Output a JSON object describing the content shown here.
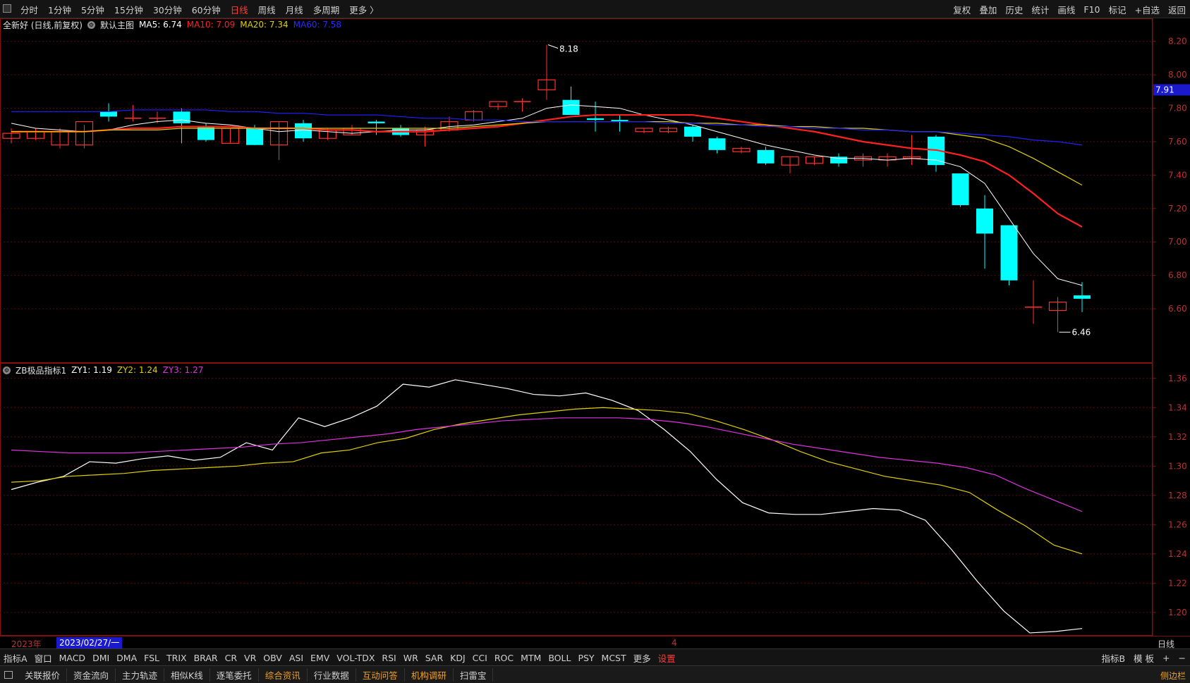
{
  "toolbar": {
    "periods": [
      "分时",
      "1分钟",
      "5分钟",
      "15分钟",
      "30分钟",
      "60分钟",
      "日线",
      "周线",
      "月线",
      "多周期",
      "更多 〉"
    ],
    "active_period": "日线",
    "tools": [
      "复权",
      "叠加",
      "历史",
      "统计",
      "画线",
      "F10",
      "标记",
      "+自选",
      "返回"
    ]
  },
  "main_legend": {
    "stock": "全新好 (日线,前复权)",
    "template": "默认主图",
    "ma5": "MA5: 6.74",
    "ma10": "MA10: 7.09",
    "ma20": "MA20: 7.34",
    "ma60": "MA60: 7.58"
  },
  "indicator_legend": {
    "name": "ZB极品指标1",
    "zy1": "ZY1: 1.19",
    "zy2": "ZY2: 1.24",
    "zy3": "ZY3: 1.27"
  },
  "colors": {
    "up": "#ff3030",
    "down": "#00ffff",
    "ma5": "#ffffff",
    "ma10": "#ff2020",
    "ma20": "#e0d000",
    "ma60": "#2020ff",
    "zy1": "#ffffff",
    "zy2": "#e0d000",
    "zy3": "#e030e0"
  },
  "chart_data": {
    "type": "candlestick",
    "price_axis": {
      "ylim": [
        6.44,
        8.22
      ],
      "ticks": [
        "8.20",
        "8.00",
        "7.80",
        "7.60",
        "7.40",
        "7.20",
        "7.00",
        "6.80",
        "6.60"
      ]
    },
    "last_price_tag": "7.91",
    "high_label": "8.18",
    "low_label": "6.46",
    "candles": [
      {
        "o": 7.62,
        "h": 7.68,
        "l": 7.59,
        "c": 7.65
      },
      {
        "o": 7.62,
        "h": 7.68,
        "l": 7.61,
        "c": 7.66
      },
      {
        "o": 7.58,
        "h": 7.68,
        "l": 7.56,
        "c": 7.66
      },
      {
        "o": 7.58,
        "h": 7.7,
        "l": 7.56,
        "c": 7.72
      },
      {
        "o": 7.78,
        "h": 7.83,
        "l": 7.72,
        "c": 7.75
      },
      {
        "o": 7.74,
        "h": 7.82,
        "l": 7.72,
        "c": 7.74
      },
      {
        "o": 7.74,
        "h": 7.78,
        "l": 7.71,
        "c": 7.74
      },
      {
        "o": 7.78,
        "h": 7.8,
        "l": 7.59,
        "c": 7.71
      },
      {
        "o": 7.69,
        "h": 7.71,
        "l": 7.6,
        "c": 7.61
      },
      {
        "o": 7.59,
        "h": 7.68,
        "l": 7.59,
        "c": 7.68
      },
      {
        "o": 7.68,
        "h": 7.7,
        "l": 7.58,
        "c": 7.58
      },
      {
        "o": 7.58,
        "h": 7.72,
        "l": 7.49,
        "c": 7.72
      },
      {
        "o": 7.71,
        "h": 7.73,
        "l": 7.6,
        "c": 7.62
      },
      {
        "o": 7.62,
        "h": 7.68,
        "l": 7.61,
        "c": 7.67
      },
      {
        "o": 7.64,
        "h": 7.7,
        "l": 7.64,
        "c": 7.68
      },
      {
        "o": 7.72,
        "h": 7.73,
        "l": 7.64,
        "c": 7.71
      },
      {
        "o": 7.68,
        "h": 7.7,
        "l": 7.63,
        "c": 7.64
      },
      {
        "o": 7.64,
        "h": 7.69,
        "l": 7.57,
        "c": 7.67
      },
      {
        "o": 7.67,
        "h": 7.75,
        "l": 7.66,
        "c": 7.72
      },
      {
        "o": 7.73,
        "h": 7.79,
        "l": 7.72,
        "c": 7.78
      },
      {
        "o": 7.81,
        "h": 7.83,
        "l": 7.79,
        "c": 7.84
      },
      {
        "o": 7.84,
        "h": 7.86,
        "l": 7.78,
        "c": 7.84
      },
      {
        "o": 7.91,
        "h": 8.18,
        "l": 7.85,
        "c": 7.97
      },
      {
        "o": 7.85,
        "h": 7.93,
        "l": 7.76,
        "c": 7.76
      },
      {
        "o": 7.74,
        "h": 7.84,
        "l": 7.66,
        "c": 7.73
      },
      {
        "o": 7.73,
        "h": 7.76,
        "l": 7.66,
        "c": 7.72
      },
      {
        "o": 7.66,
        "h": 7.68,
        "l": 7.65,
        "c": 7.68
      },
      {
        "o": 7.66,
        "h": 7.69,
        "l": 7.65,
        "c": 7.68
      },
      {
        "o": 7.69,
        "h": 7.7,
        "l": 7.6,
        "c": 7.63
      },
      {
        "o": 7.62,
        "h": 7.63,
        "l": 7.53,
        "c": 7.55
      },
      {
        "o": 7.54,
        "h": 7.57,
        "l": 7.53,
        "c": 7.56
      },
      {
        "o": 7.55,
        "h": 7.57,
        "l": 7.46,
        "c": 7.47
      },
      {
        "o": 7.46,
        "h": 7.51,
        "l": 7.41,
        "c": 7.51
      },
      {
        "o": 7.47,
        "h": 7.51,
        "l": 7.46,
        "c": 7.51
      },
      {
        "o": 7.51,
        "h": 7.53,
        "l": 7.45,
        "c": 7.47
      },
      {
        "o": 7.49,
        "h": 7.53,
        "l": 7.45,
        "c": 7.51
      },
      {
        "o": 7.49,
        "h": 7.53,
        "l": 7.45,
        "c": 7.51
      },
      {
        "o": 7.5,
        "h": 7.64,
        "l": 7.46,
        "c": 7.51
      },
      {
        "o": 7.63,
        "h": 7.64,
        "l": 7.42,
        "c": 7.46
      },
      {
        "o": 7.41,
        "h": 7.41,
        "l": 7.21,
        "c": 7.22
      },
      {
        "o": 7.2,
        "h": 7.28,
        "l": 6.84,
        "c": 7.05
      },
      {
        "o": 7.1,
        "h": 7.1,
        "l": 6.74,
        "c": 6.77
      },
      {
        "o": 6.61,
        "h": 6.77,
        "l": 6.51,
        "c": 6.61
      },
      {
        "o": 6.59,
        "h": 6.67,
        "l": 6.46,
        "c": 6.64
      },
      {
        "o": 6.68,
        "h": 6.76,
        "l": 6.58,
        "c": 6.66
      }
    ],
    "ma_series": [
      {
        "name": "MA5",
        "values": [
          7.71,
          7.68,
          7.67,
          7.66,
          7.67,
          7.7,
          7.72,
          7.73,
          7.71,
          7.7,
          7.68,
          7.66,
          7.67,
          7.66,
          7.65,
          7.66,
          7.67,
          7.67,
          7.69,
          7.7,
          7.72,
          7.74,
          7.8,
          7.82,
          7.81,
          7.8,
          7.76,
          7.73,
          7.7,
          7.66,
          7.62,
          7.58,
          7.55,
          7.52,
          7.5,
          7.5,
          7.49,
          7.5,
          7.49,
          7.45,
          7.35,
          7.14,
          6.93,
          6.78,
          6.74
        ]
      },
      {
        "name": "MA10",
        "values": [
          7.66,
          7.66,
          7.66,
          7.66,
          7.67,
          7.68,
          7.68,
          7.69,
          7.69,
          7.69,
          7.68,
          7.68,
          7.68,
          7.67,
          7.67,
          7.66,
          7.66,
          7.66,
          7.67,
          7.68,
          7.69,
          7.71,
          7.73,
          7.75,
          7.76,
          7.76,
          7.76,
          7.76,
          7.76,
          7.74,
          7.72,
          7.7,
          7.68,
          7.66,
          7.63,
          7.6,
          7.58,
          7.56,
          7.55,
          7.52,
          7.48,
          7.4,
          7.29,
          7.17,
          7.09
        ]
      },
      {
        "name": "MA20",
        "values": [
          7.66,
          7.66,
          7.66,
          7.66,
          7.67,
          7.67,
          7.67,
          7.68,
          7.68,
          7.68,
          7.68,
          7.68,
          7.68,
          7.68,
          7.68,
          7.68,
          7.68,
          7.68,
          7.68,
          7.69,
          7.7,
          7.71,
          7.72,
          7.72,
          7.72,
          7.72,
          7.72,
          7.72,
          7.71,
          7.71,
          7.7,
          7.7,
          7.69,
          7.69,
          7.68,
          7.68,
          7.67,
          7.66,
          7.66,
          7.64,
          7.62,
          7.57,
          7.5,
          7.42,
          7.34
        ]
      },
      {
        "name": "MA60",
        "values": [
          7.78,
          7.78,
          7.78,
          7.78,
          7.78,
          7.79,
          7.79,
          7.79,
          7.79,
          7.78,
          7.78,
          7.77,
          7.77,
          7.76,
          7.76,
          7.76,
          7.75,
          7.74,
          7.74,
          7.73,
          7.73,
          7.72,
          7.72,
          7.72,
          7.72,
          7.72,
          7.72,
          7.71,
          7.71,
          7.7,
          7.7,
          7.69,
          7.69,
          7.68,
          7.68,
          7.67,
          7.67,
          7.66,
          7.66,
          7.65,
          7.64,
          7.63,
          7.61,
          7.6,
          7.58
        ]
      }
    ],
    "indicator": {
      "name": "ZB极品指标1",
      "ylim": [
        1.185,
        1.37
      ],
      "ticks": [
        "1.36",
        "1.34",
        "1.32",
        "1.30",
        "1.28",
        "1.26",
        "1.24",
        "1.22",
        "1.20"
      ],
      "series": [
        {
          "name": "ZY1",
          "values": [
            1.284,
            1.289,
            1.293,
            1.303,
            1.302,
            1.305,
            1.307,
            1.304,
            1.306,
            1.316,
            1.311,
            1.333,
            1.327,
            1.333,
            1.341,
            1.356,
            1.354,
            1.359,
            1.356,
            1.353,
            1.349,
            1.348,
            1.35,
            1.345,
            1.338,
            1.325,
            1.31,
            1.291,
            1.275,
            1.268,
            1.267,
            1.267,
            1.269,
            1.271,
            1.27,
            1.263,
            1.243,
            1.221,
            1.201,
            1.186,
            1.187,
            1.189
          ]
        },
        {
          "name": "ZY2",
          "values": [
            1.289,
            1.29,
            1.293,
            1.294,
            1.295,
            1.297,
            1.298,
            1.299,
            1.3,
            1.302,
            1.303,
            1.309,
            1.311,
            1.316,
            1.319,
            1.325,
            1.329,
            1.332,
            1.335,
            1.337,
            1.339,
            1.34,
            1.339,
            1.338,
            1.336,
            1.331,
            1.325,
            1.318,
            1.31,
            1.303,
            1.298,
            1.293,
            1.29,
            1.287,
            1.282,
            1.27,
            1.259,
            1.246,
            1.24
          ]
        },
        {
          "name": "ZY3",
          "values": [
            1.311,
            1.31,
            1.309,
            1.309,
            1.309,
            1.31,
            1.311,
            1.312,
            1.313,
            1.315,
            1.316,
            1.318,
            1.32,
            1.322,
            1.325,
            1.327,
            1.329,
            1.331,
            1.332,
            1.333,
            1.333,
            1.333,
            1.332,
            1.33,
            1.327,
            1.323,
            1.319,
            1.315,
            1.312,
            1.309,
            1.306,
            1.304,
            1.302,
            1.299,
            1.294,
            1.285,
            1.277,
            1.269
          ]
        }
      ]
    }
  },
  "date_bar": {
    "year": "2023年",
    "cursor_date": "2023/02/27/一",
    "month_mark": "4",
    "period": "日线"
  },
  "indicator_tabs": [
    "指标A",
    "窗口",
    "MACD",
    "DMI",
    "DMA",
    "FSL",
    "TRIX",
    "BRAR",
    "CR",
    "VR",
    "OBV",
    "ASI",
    "EMV",
    "VOL-TDX",
    "RSI",
    "WR",
    "SAR",
    "KDJ",
    "CCI",
    "ROC",
    "MTM",
    "BOLL",
    "PSY",
    "MCST",
    "更多",
    "设置"
  ],
  "indicator_right": [
    "指标B",
    "模 板",
    "+",
    "−"
  ],
  "bottom_tabs": [
    "关联报价",
    "资金流向",
    "主力轨迹",
    "相似K线",
    "逐笔委托",
    "综合资讯",
    "行业数据",
    "互动问答",
    "机构调研",
    "扫雷宝"
  ],
  "bottom_orange": [
    "综合资讯",
    "互动问答",
    "机构调研"
  ],
  "sidebar_toggle": "侧边栏"
}
